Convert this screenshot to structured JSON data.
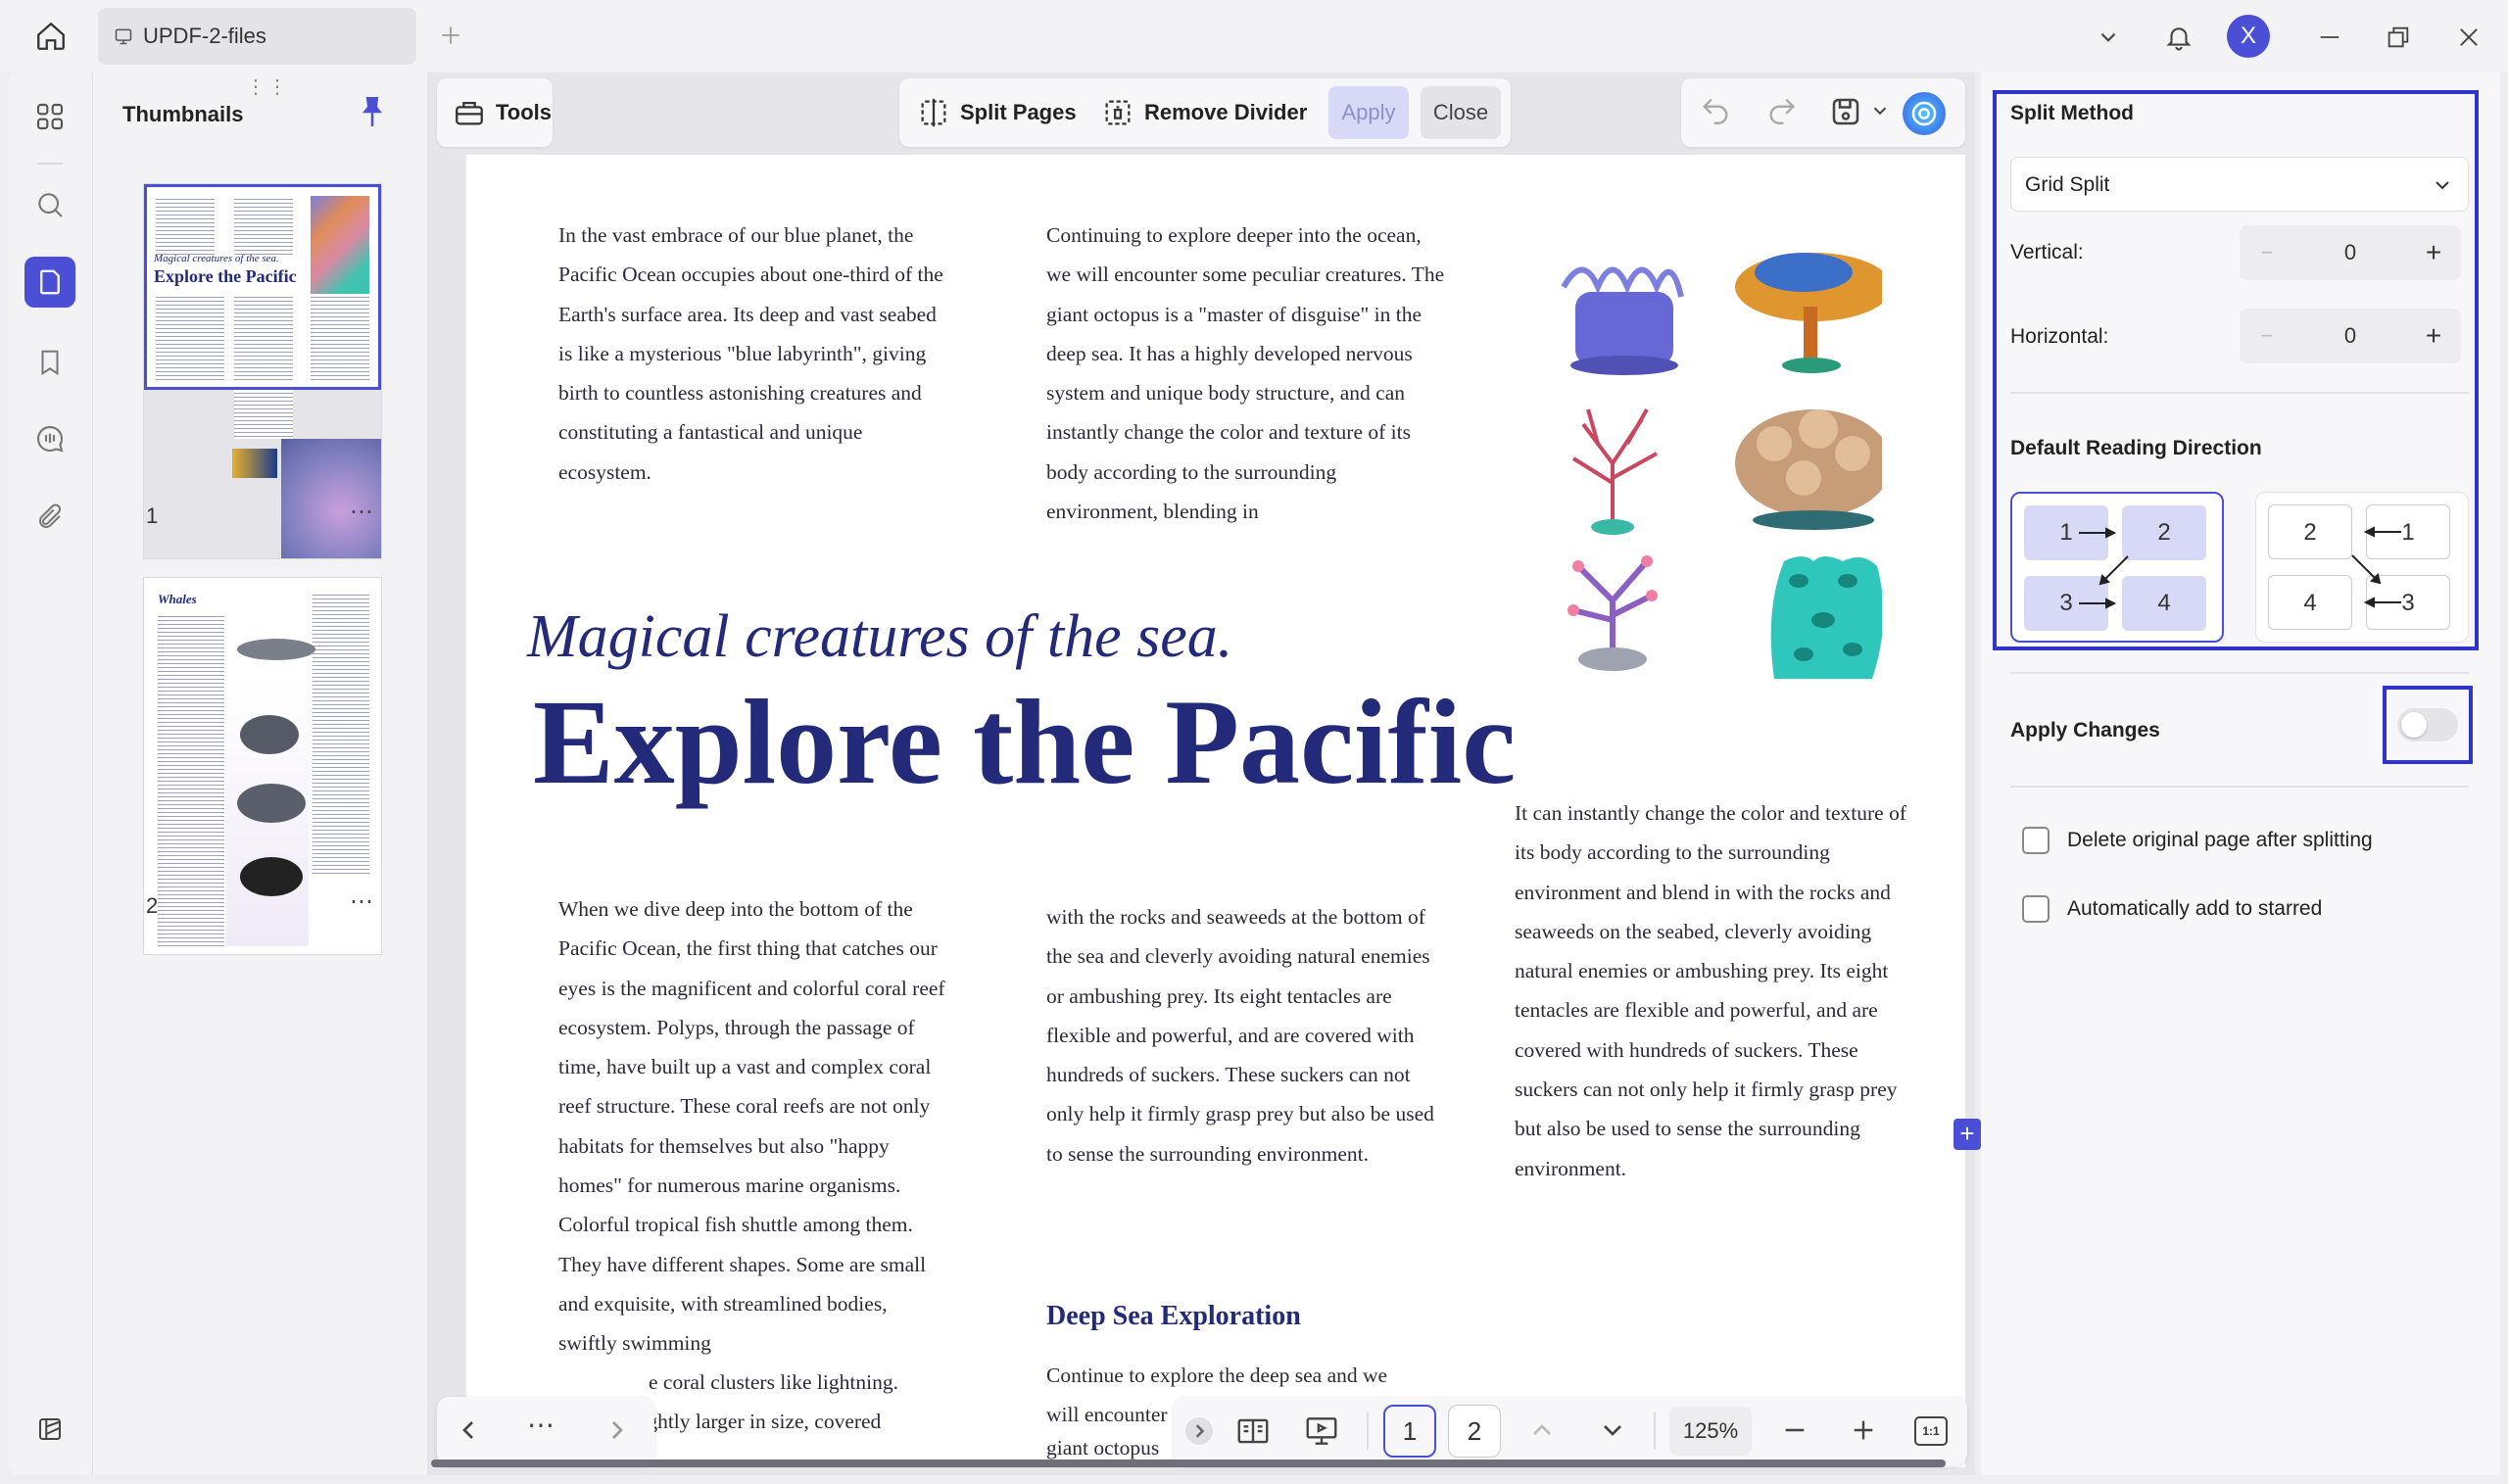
{
  "titlebar": {
    "tab_title": "UPDF-2-files",
    "user_initial": "X"
  },
  "thumbnails": {
    "title": "Thumbnails",
    "pages": [
      {
        "number": "1",
        "more": "⋯",
        "heading_small": "Magical creatures of the sea.",
        "heading_big": "Explore the Pacific"
      },
      {
        "number": "2",
        "more": "⋯",
        "heading_small": "Whales"
      }
    ]
  },
  "toolbar": {
    "tools_label": "Tools",
    "split_pages_label": "Split Pages",
    "remove_divider_label": "Remove Divider",
    "apply_label": "Apply",
    "close_label": "Close"
  },
  "document": {
    "col1_top": "In the vast embrace of our blue planet, the Pacific Ocean occupies about one-third of the Earth's surface area. Its deep and vast seabed is like a mysterious \"blue labyrinth\", giving birth to countless astonishing creatures and constituting a fantastical and unique ecosystem.",
    "col2_top": "Continuing to explore deeper into the ocean, we will encounter some peculiar creatures. The giant octopus is a \"master of disguise\" in the deep sea. It has a highly developed nervous system and unique body structure, and can instantly change the color and texture of its body according to the surrounding environment, blending in",
    "subtitle": "Magical creatures of the sea.",
    "title": "Explore the Pacific",
    "col1_bottom": "When we dive deep into the bottom of the Pacific Ocean, the first thing that catches our eyes is the magnificent and colorful coral reef ecosystem. Polyps, through the passage of time, have built up a vast and complex coral reef structure. These coral reefs are not only habitats for themselves but also \"happy homes\" for numerous marine organisms. Colorful tropical fish shuttle among them. They have different shapes. Some are small and exquisite, with streamlined bodies, swiftly swimming",
    "col1_bottom_tail1": "e coral clusters like lightning.",
    "col1_bottom_tail2": "slightly larger in size, covered",
    "col2_bottom": "with the rocks and seaweeds at the bottom of the sea and cleverly avoiding natural enemies or ambushing prey. Its eight tentacles are flexible and powerful, and are covered with hundreds of suckers. These suckers can not only help it firmly grasp prey but also be used to sense the surrounding environment.",
    "section_heading": "Deep Sea Exploration",
    "col2_section_line1": "Continue to explore the deep sea and we",
    "col2_section_line2": "will encounter",
    "col2_section_line3": "giant octopus",
    "col3": "It can instantly change the color and texture of its body according to the surrounding environment and blend in with the rocks and seaweeds on the seabed, cleverly avoiding natural enemies or ambushing prey. Its eight tentacles are flexible and powerful, and are covered with hundreds of suckers. These suckers can not only help it firmly grasp prey but also be used to sense the surrounding environment."
  },
  "bottombar": {
    "more": "⋯",
    "page_1": "1",
    "page_2": "2",
    "zoom": "125%",
    "fit_label": "1:1"
  },
  "split_panel": {
    "split_method_title": "Split Method",
    "split_method_value": "Grid Split",
    "vertical_label": "Vertical:",
    "vertical_value": "0",
    "horizontal_label": "Horizontal:",
    "horizontal_value": "0",
    "minus": "−",
    "plus": "+",
    "reading_direction_title": "Default Reading Direction",
    "ltr_cells": [
      "1",
      "2",
      "3",
      "4"
    ],
    "rtl_cells": [
      "2",
      "1",
      "4",
      "3"
    ],
    "apply_changes_label": "Apply Changes",
    "apply_changes_on": false,
    "delete_original_label": "Delete original page after splitting",
    "auto_star_label": "Automatically add to starred"
  },
  "colors": {
    "accent": "#4b4fd6",
    "selection_outline": "#2e35c8",
    "title_navy": "#232a7a",
    "cell_fill": "#d7d9f7"
  }
}
